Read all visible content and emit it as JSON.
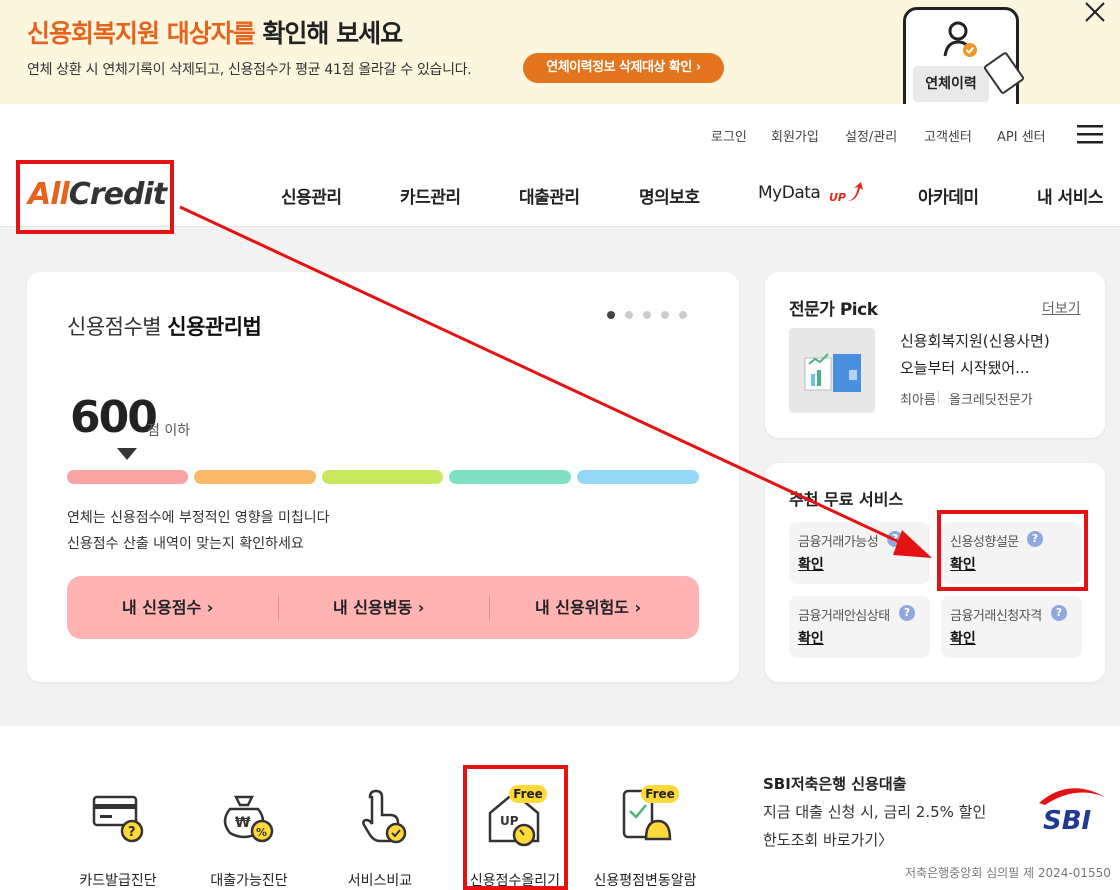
{
  "banner": {
    "title_highlight": "신용회복지원 대상자를",
    "title_rest": " 확인해 보세요",
    "subtitle": "연체 상환 시 연체기록이 삭제되고, 신용점수가 평균 41점 올라갈 수 있습니다.",
    "button": "연체이력정보 삭제대상 확인 ›",
    "phone_label": "연체이력"
  },
  "header": {
    "util_links": [
      "로그인",
      "회원가입",
      "설정/관리",
      "고객센터",
      "API 센터"
    ],
    "logo_part1": "All",
    "logo_part2": "Credit",
    "nav": [
      "신용관리",
      "카드관리",
      "대출관리",
      "명의보호",
      "MyData",
      "아카데미",
      "내 서비스"
    ],
    "mydata_badge": "UP"
  },
  "credit_card": {
    "title_light": "신용점수별 ",
    "title_bold": "신용관리법",
    "score": "600",
    "score_unit": "점 이하",
    "desc1": "연체는 신용점수에 부정적인 영향을 미칩니다",
    "desc2": "신용점수 산출 내역이 맞는지 확인하세요",
    "buttons": [
      "내 신용점수 ›",
      "내 신용변동 ›",
      "내 신용위험도 ›"
    ],
    "segment_colors": [
      "#f9a3a3",
      "#fbb867",
      "#c7e85f",
      "#7fe0c3",
      "#94d8f5"
    ],
    "slide_index": 1,
    "slide_count": 5
  },
  "expert_pick": {
    "title": "전문가 Pick",
    "more": "더보기",
    "headline1": "신용회복지원(신용사면)",
    "headline2": "오늘부터 시작됐어...",
    "author": "최아름",
    "role": "올크레딧전문가"
  },
  "services": {
    "title": "추천 무료 서비스",
    "items": [
      {
        "label": "금융거래가능성",
        "link": "확인"
      },
      {
        "label": "신용성향설문",
        "link": "확인"
      },
      {
        "label": "금융거래안심상태",
        "link": "확인"
      },
      {
        "label": "금융거래신청자격",
        "link": "확인"
      }
    ]
  },
  "bottom": {
    "tools": [
      "카드발급진단",
      "대출가능진단",
      "서비스비교",
      "신용점수올리기",
      "신용평점변동알람"
    ],
    "free_badge": "Free",
    "up_label": "UP",
    "ad_title": "SBI저축은행 신용대출",
    "ad_line1": "지금 대출 신청 시, 금리 2.5% 할인",
    "ad_line2": "한도조회 바로가기〉",
    "ad_note": "저축은행중앙회 심의필 제 2024-01550",
    "ad_brand": "SBI"
  },
  "colors": {
    "accent": "#e5631d",
    "annotation_red": "#e41212",
    "credit_bar": "#ffb3b3"
  }
}
